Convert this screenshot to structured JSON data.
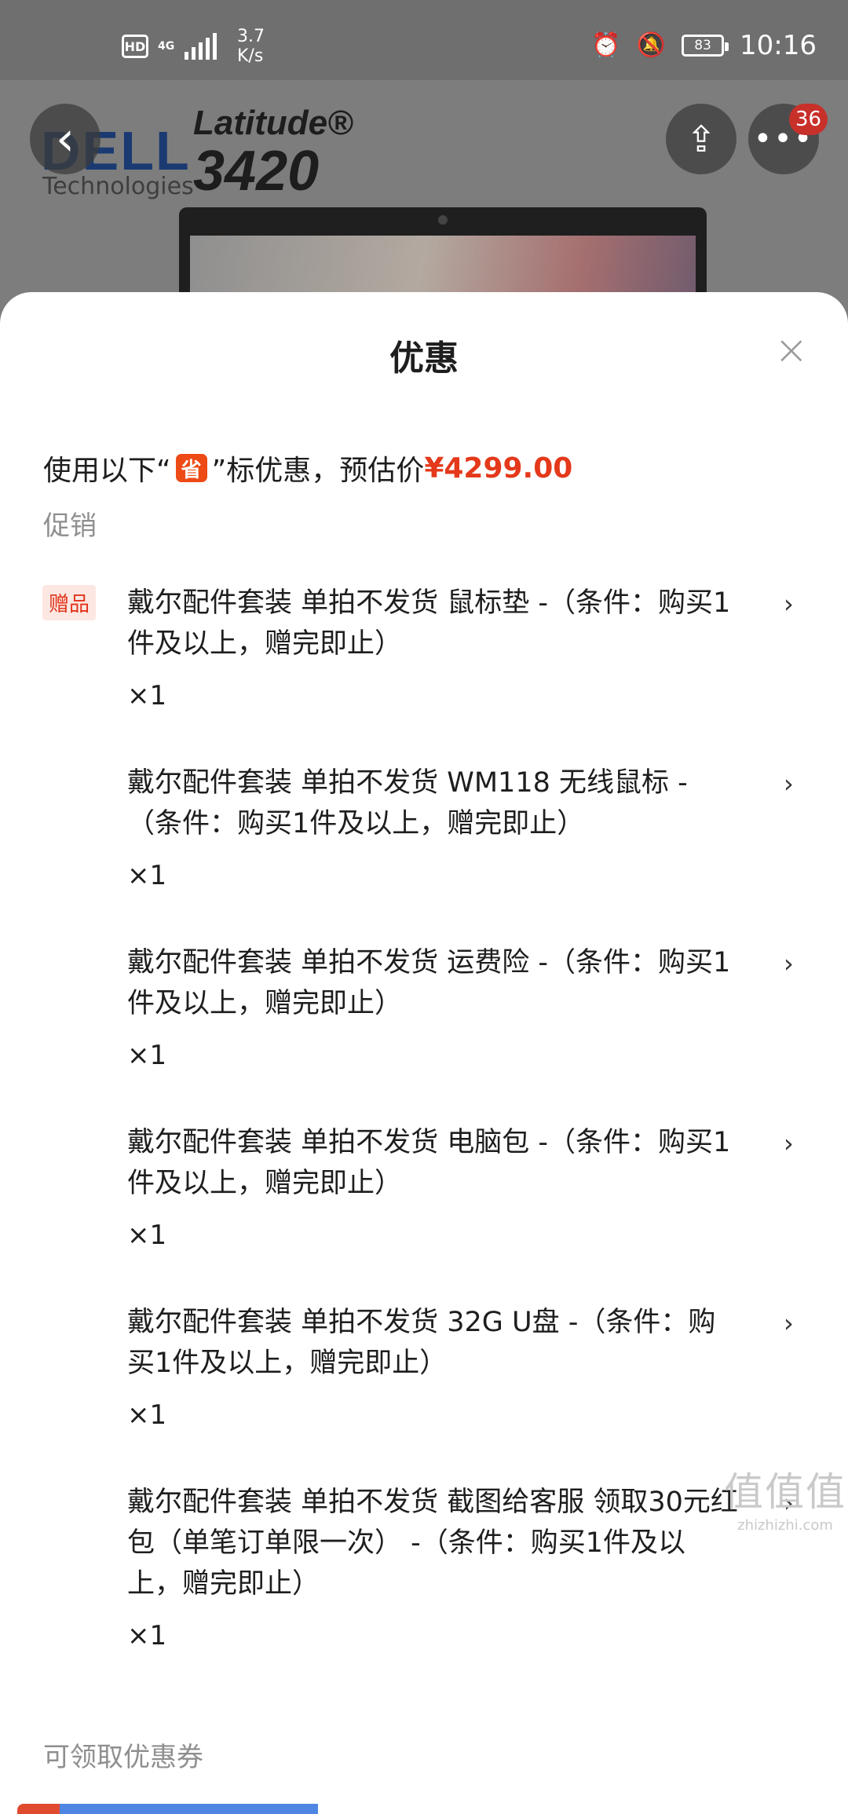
{
  "status_bar": {
    "hd": "HD",
    "network": "4G",
    "speed_value": "3.7",
    "speed_unit": "K/s",
    "battery": "83",
    "time": "10:16",
    "icons": [
      "alarm-icon",
      "bell-off-icon",
      "battery-icon",
      "signal-icon"
    ]
  },
  "product": {
    "brand": "DELL",
    "brand_sub": "Technologies",
    "model_line1": "Latitude®",
    "model_line2": "3420",
    "back_glyph": "‹",
    "share_glyph": "⇪",
    "more_glyph": "•••",
    "message_count": "36"
  },
  "sheet": {
    "title": "优惠",
    "close_glyph": "×",
    "summary_prefix": "使用以下“",
    "summary_badge": "省",
    "summary_mid": "”标优惠，预估价",
    "summary_price": "¥4299.00",
    "section_promo": "促销",
    "gift_tag": "赠品",
    "chevron": "›",
    "promos": [
      {
        "desc": "戴尔配件套装 单拍不发货 鼠标垫 -（条件：购买1件及以上，赠完即止）",
        "qty": "×1"
      },
      {
        "desc": "戴尔配件套装 单拍不发货 WM118 无线鼠标 -（条件：购买1件及以上，赠完即止）",
        "qty": "×1"
      },
      {
        "desc": "戴尔配件套装 单拍不发货 运费险 -（条件：购买1件及以上，赠完即止）",
        "qty": "×1"
      },
      {
        "desc": "戴尔配件套装 单拍不发货 电脑包 -（条件：购买1件及以上，赠完即止）",
        "qty": "×1"
      },
      {
        "desc": "戴尔配件套装 单拍不发货 32G U盘 -（条件：购买1件及以上，赠完即止）",
        "qty": "×1"
      },
      {
        "desc": "戴尔配件套装 单拍不发货 截图给客服 领取30元红包（单笔订单限一次） -（条件：购买1件及以上，赠完即止）",
        "qty": "×1"
      }
    ],
    "section_coupon": "可领取优惠券"
  },
  "watermark": {
    "line1": "值值值",
    "line2": "zhizhizhi.com"
  },
  "colors": {
    "accent": "#e4391a",
    "sheng_badge": "#ee4a16",
    "gift_tag_bg": "#fde7e3",
    "coupon_blue": "#4f86e4"
  }
}
